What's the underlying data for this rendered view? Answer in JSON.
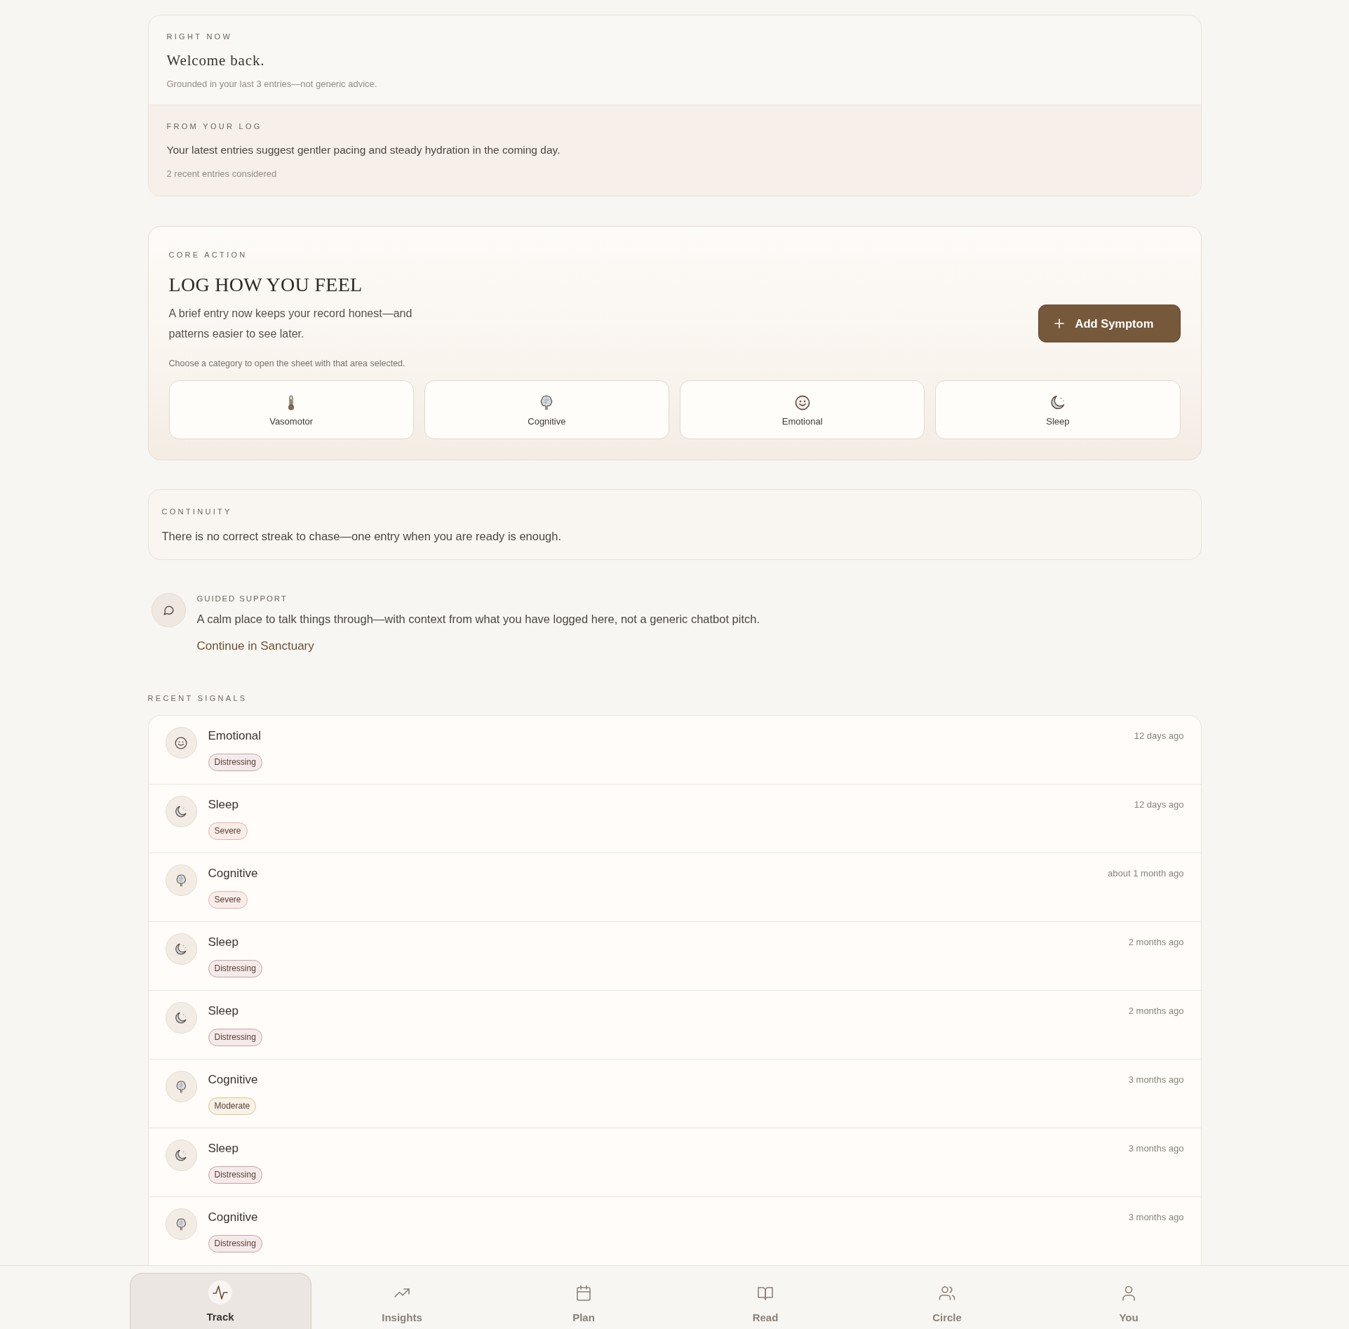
{
  "right_now": {
    "label": "RIGHT NOW",
    "title": "Welcome back.",
    "note": "Grounded in your last 3 entries—not generic advice."
  },
  "from_your_log": {
    "label": "FROM YOUR LOG",
    "text": "Your latest entries suggest gentler pacing and steady hydration in the coming day.",
    "note": "2 recent entries considered"
  },
  "core_action": {
    "label": "CORE ACTION",
    "title": "LOG HOW YOU FEEL",
    "description": "A brief entry now keeps your record honest—and patterns easier to see later.",
    "button": "Add Symptom",
    "hint": "Choose a category to open the sheet with that area selected.",
    "categories": [
      {
        "kind": "thermometer",
        "label": "Vasomotor"
      },
      {
        "kind": "brain",
        "label": "Cognitive"
      },
      {
        "kind": "smiley",
        "label": "Emotional"
      },
      {
        "kind": "moon",
        "label": "Sleep"
      }
    ]
  },
  "continuity": {
    "label": "CONTINUITY",
    "text": "There is no correct streak to chase—one entry when you are ready is enough."
  },
  "guided_support": {
    "label": "GUIDED SUPPORT",
    "text": "A calm place to talk things through—with context from what you have logged here, not a generic chatbot pitch.",
    "link": "Continue in Sanctuary"
  },
  "recent_signals": {
    "label": "RECENT SIGNALS",
    "entries": [
      {
        "kind": "smiley",
        "name": "Emotional",
        "severity": {
          "text": "Distressing",
          "color": "#c9a3a8"
        },
        "time": "12 days ago"
      },
      {
        "kind": "moon",
        "name": "Sleep",
        "severity": {
          "text": "Severe",
          "color": "#e3b2ab"
        },
        "time": "12 days ago"
      },
      {
        "kind": "brain",
        "name": "Cognitive",
        "severity": {
          "text": "Severe",
          "color": "#e3b2ab"
        },
        "time": "about 1 month ago"
      },
      {
        "kind": "moon",
        "name": "Sleep",
        "severity": {
          "text": "Distressing",
          "color": "#c9a3a8"
        },
        "time": "2 months ago"
      },
      {
        "kind": "moon",
        "name": "Sleep",
        "severity": {
          "text": "Distressing",
          "color": "#c9a3a8"
        },
        "time": "2 months ago"
      },
      {
        "kind": "brain",
        "name": "Cognitive",
        "severity": {
          "text": "Moderate",
          "color": "#dcc494"
        },
        "time": "3 months ago"
      },
      {
        "kind": "moon",
        "name": "Sleep",
        "severity": {
          "text": "Distressing",
          "color": "#c9a3a8"
        },
        "time": "3 months ago"
      },
      {
        "kind": "brain",
        "name": "Cognitive",
        "severity": {
          "text": "Distressing",
          "color": "#c9a3a8"
        },
        "time": "3 months ago"
      }
    ]
  },
  "nav": [
    {
      "kind": "pulse",
      "label": "Track",
      "selected": true
    },
    {
      "kind": "trend",
      "label": "Insights",
      "selected": false
    },
    {
      "kind": "calendar",
      "label": "Plan",
      "selected": false
    },
    {
      "kind": "book",
      "label": "Read",
      "selected": false
    },
    {
      "kind": "people",
      "label": "Circle",
      "selected": false
    },
    {
      "kind": "person",
      "label": "You",
      "selected": false
    }
  ]
}
